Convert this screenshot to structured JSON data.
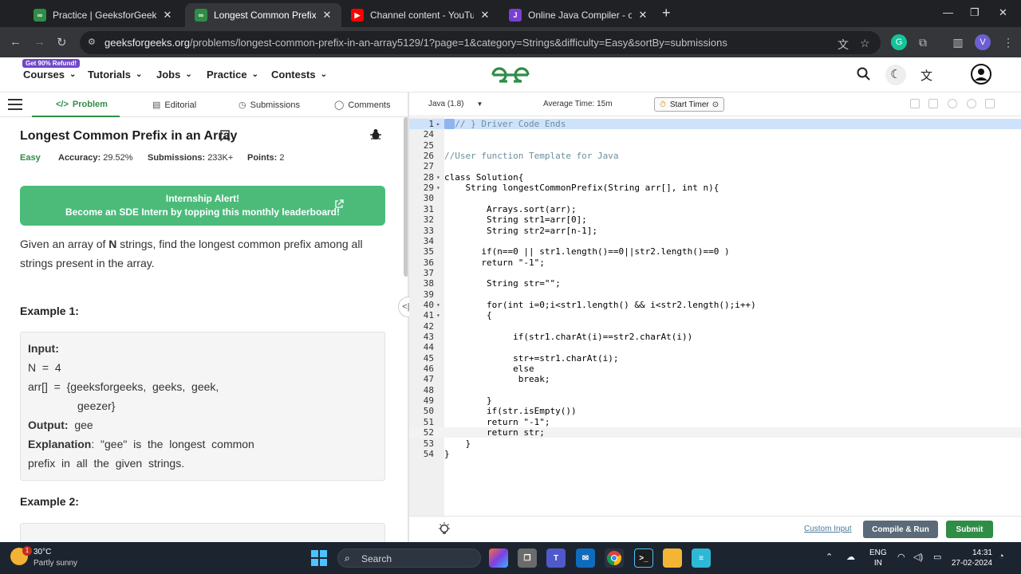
{
  "browser": {
    "tabs": [
      {
        "title": "Practice | GeeksforGeeks | A co",
        "fav": "gfg"
      },
      {
        "title": "Longest Common Prefix in an A",
        "fav": "gfg"
      },
      {
        "title": "Channel content - YouTube Stu",
        "fav": "yt"
      },
      {
        "title": "Online Java Compiler - online e",
        "fav": "java"
      }
    ],
    "url_host": "geeksforgeeks.org",
    "url_path": "/problems/longest-common-prefix-in-an-array5129/1?page=1&category=Strings&difficulty=Easy&sortBy=submissions",
    "profile_initial": "V"
  },
  "header": {
    "promo": "Get 90% Refund!",
    "nav": [
      "Courses",
      "Tutorials",
      "Jobs",
      "Practice",
      "Contests"
    ]
  },
  "left_tabs": [
    "Problem",
    "Editorial",
    "Submissions",
    "Comments"
  ],
  "problem": {
    "title": "Longest Common Prefix in an Array",
    "difficulty": "Easy",
    "accuracy_label": "Accuracy:",
    "accuracy": "29.52%",
    "submissions_label": "Submissions:",
    "submissions": "233K+",
    "points_label": "Points:",
    "points": "2",
    "alert_line1": "Internship Alert!",
    "alert_line2": "Become an SDE Intern by topping this monthly leaderboard!",
    "desc_before": "Given an array of ",
    "desc_bold": "N",
    "desc_after": " strings, find the longest common prefix among all strings present in the array.",
    "example1_title": "Example 1:",
    "example1": {
      "input_label": "Input:",
      "n_line": "N  =  4",
      "arr_line1": "arr[]  =  {geeksforgeeks,  geeks,  geek,",
      "arr_line2": "geezer}",
      "output_label": "Output:",
      "output_value": "gee",
      "explanation_label": "Explanation",
      "explanation_line1": ":  \"gee\"  is  the  longest  common",
      "explanation_line2": "prefix  in  all  the  given  strings."
    },
    "example2_title": "Example 2:"
  },
  "editor": {
    "language": "Java (1.8)",
    "avg_time": "Average Time: 15m",
    "timer": "Start Timer",
    "custom_input": "Custom Input",
    "run": "Compile & Run",
    "submit": "Submit",
    "lines": [
      {
        "n": "1",
        "fold": "▸",
        "text": "// } Driver Code Ends",
        "hl": "blue",
        "marker": true
      },
      {
        "n": "24",
        "text": ""
      },
      {
        "n": "25",
        "text": ""
      },
      {
        "n": "26",
        "text": "//User function Template for Java"
      },
      {
        "n": "27",
        "text": ""
      },
      {
        "n": "28",
        "fold": "▾",
        "text": "class Solution{"
      },
      {
        "n": "29",
        "fold": "▾",
        "text": "    String longestCommonPrefix(String arr[], int n){"
      },
      {
        "n": "30",
        "text": ""
      },
      {
        "n": "31",
        "text": "        Arrays.sort(arr);"
      },
      {
        "n": "32",
        "text": "        String str1=arr[0];"
      },
      {
        "n": "33",
        "text": "        String str2=arr[n-1];"
      },
      {
        "n": "34",
        "text": ""
      },
      {
        "n": "35",
        "text": "       if(n==0 || str1.length()==0||str2.length()==0 )"
      },
      {
        "n": "36",
        "text": "       return \"-1\";"
      },
      {
        "n": "37",
        "text": ""
      },
      {
        "n": "38",
        "text": "        String str=\"\";"
      },
      {
        "n": "39",
        "text": ""
      },
      {
        "n": "40",
        "fold": "▾",
        "text": "        for(int i=0;i<str1.length() && i<str2.length();i++)"
      },
      {
        "n": "41",
        "fold": "▾",
        "text": "        {"
      },
      {
        "n": "42",
        "text": ""
      },
      {
        "n": "43",
        "text": "             if(str1.charAt(i)==str2.charAt(i))"
      },
      {
        "n": "44",
        "text": ""
      },
      {
        "n": "45",
        "text": "             str+=str1.charAt(i);"
      },
      {
        "n": "46",
        "text": "             else"
      },
      {
        "n": "47",
        "text": "              break;"
      },
      {
        "n": "48",
        "text": ""
      },
      {
        "n": "49",
        "text": "        }"
      },
      {
        "n": "50",
        "text": "        if(str.isEmpty())"
      },
      {
        "n": "51",
        "text": "        return \"-1\";"
      },
      {
        "n": "52",
        "text": "        return str;",
        "hl": "cur"
      },
      {
        "n": "53",
        "text": "    }"
      },
      {
        "n": "54",
        "text": "}"
      }
    ]
  },
  "taskbar": {
    "temp": "30°C",
    "weather": "Partly sunny",
    "badge": "1",
    "search": "Search",
    "lang1": "ENG",
    "lang2": "IN",
    "time": "14:31",
    "date": "27-02-2024"
  },
  "colors": {
    "gfg_green": "#2f8d46",
    "alert_green": "#4cbb7a",
    "run_btn": "#5a6a78"
  }
}
